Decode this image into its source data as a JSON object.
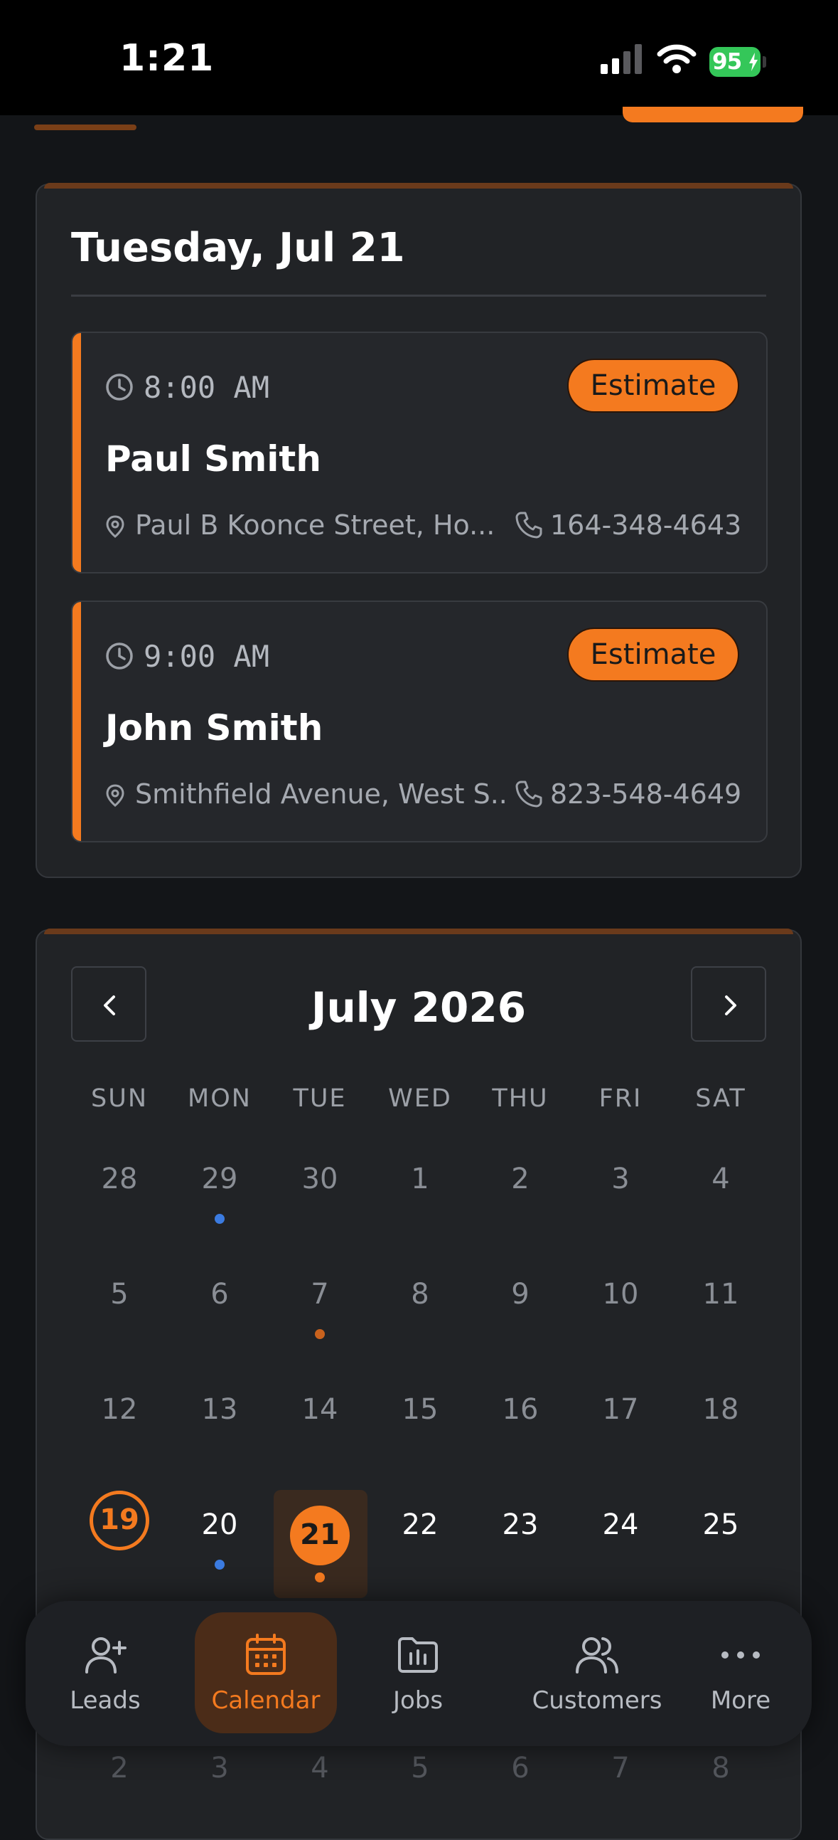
{
  "status_bar": {
    "time": "1:21",
    "battery": "95"
  },
  "day_view": {
    "title": "Tuesday, Jul 21",
    "appointments": [
      {
        "time": "8:00 AM",
        "type": "Estimate",
        "name": "Paul Smith",
        "address": "Paul B Koonce Street, Ho...",
        "phone": "164-348-4643"
      },
      {
        "time": "9:00 AM",
        "type": "Estimate",
        "name": "John Smith",
        "address": "Smithfield Avenue, West S...",
        "phone": "823-548-4649"
      }
    ]
  },
  "calendar": {
    "month_title": "July 2026",
    "weekdays": [
      "SUN",
      "MON",
      "TUE",
      "WED",
      "THU",
      "FRI",
      "SAT"
    ],
    "weeks": [
      [
        "28",
        "29",
        "30",
        "1",
        "2",
        "3",
        "4"
      ],
      [
        "5",
        "6",
        "7",
        "8",
        "9",
        "10",
        "11"
      ],
      [
        "12",
        "13",
        "14",
        "15",
        "16",
        "17",
        "18"
      ],
      [
        "19",
        "20",
        "21",
        "22",
        "23",
        "24",
        "25"
      ],
      [
        "2",
        "3",
        "4",
        "5",
        "6",
        "7",
        "8"
      ]
    ]
  },
  "bottom_nav": {
    "items": [
      {
        "label": "Leads",
        "icon": "user-plus-icon"
      },
      {
        "label": "Calendar",
        "icon": "calendar-icon",
        "active": true
      },
      {
        "label": "Jobs",
        "icon": "folder-icon"
      },
      {
        "label": "Customers",
        "icon": "users-icon"
      },
      {
        "label": "More",
        "icon": "more-dots-icon"
      }
    ]
  },
  "colors": {
    "accent": "#f47a1f",
    "background": "#131518",
    "card": "#212326",
    "event_dot_blue": "#3b7be0"
  }
}
